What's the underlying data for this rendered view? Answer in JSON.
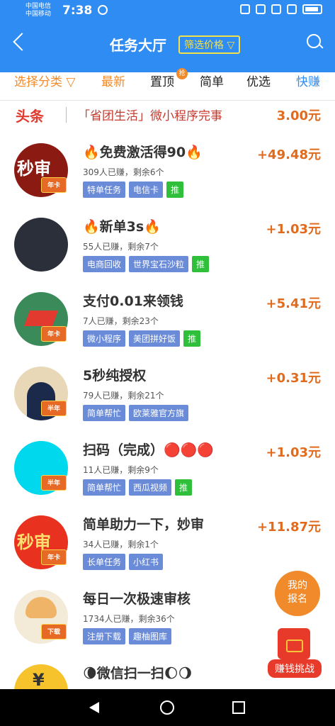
{
  "status": {
    "carrier1": "中国电信",
    "carrier2": "中国移动",
    "time": "7:38"
  },
  "header": {
    "title": "任务大厅",
    "filter": "筛选价格 ▽"
  },
  "tabs": {
    "category": "选择分类 ▽",
    "latest": "最新",
    "pin": "置顶",
    "pin_badge": "抢",
    "simple": "简单",
    "preferred": "优选",
    "fast": "快赚"
  },
  "banner": {
    "brand": "头条",
    "text": "「省团生活」微小程序完事",
    "price": "3.00元"
  },
  "items": [
    {
      "title": "🔥免费激活得90🔥",
      "meta": "309人已赚，剩余6个",
      "tags": [
        "特单任务",
        "电信卡"
      ],
      "tui": "推",
      "price": "+49.48元",
      "avatar_label": "秒审",
      "badge": "年卡"
    },
    {
      "title": "🔥新单3s🔥",
      "meta": "55人已赚，剩余7个",
      "tags": [
        "电商回收",
        "世界宝石沙粒"
      ],
      "tui": "推",
      "price": "+1.03元",
      "avatar_label": "",
      "badge": ""
    },
    {
      "title": "支付0.01来领钱",
      "meta": "7人已赚，剩余23个",
      "tags": [
        "微小程序",
        "美团拼好饭"
      ],
      "tui": "推",
      "price": "+5.41元",
      "avatar_label": "",
      "badge": "年卡"
    },
    {
      "title": "5秒纯授权",
      "meta": "79人已赚，剩余21个",
      "tags": [
        "简单帮忙",
        "欧莱雅官方旗"
      ],
      "tui": "",
      "price": "+0.31元",
      "avatar_label": "",
      "badge": "半年"
    },
    {
      "title": "扫码（完成）🔴🔴🔴",
      "meta": "11人已赚，剩余9个",
      "tags": [
        "简单帮忙",
        "西瓜视频"
      ],
      "tui": "推",
      "price": "+1.03元",
      "avatar_label": "",
      "badge": "半年"
    },
    {
      "title": "简单助力一下，妙审",
      "meta": "34人已赚，剩余1个",
      "tags": [
        "长单任务",
        "小红书"
      ],
      "tui": "",
      "price": "+11.87元",
      "avatar_label": "秒审",
      "badge": "年卡"
    },
    {
      "title": "每日一次极速审核",
      "meta": "1734人已赚，剩余36个",
      "tags": [
        "注册下载",
        "趣柚图库"
      ],
      "tui": "",
      "price": "",
      "avatar_label": "",
      "badge": "下载"
    },
    {
      "title": "🌘微信扫一扫🌔🌖",
      "meta": "",
      "tags": [],
      "tui": "",
      "price": "",
      "avatar_label": "¥",
      "badge": ""
    }
  ],
  "float": {
    "report_line1": "我的",
    "report_line2": "报名",
    "challenge": "赚钱挑战"
  }
}
